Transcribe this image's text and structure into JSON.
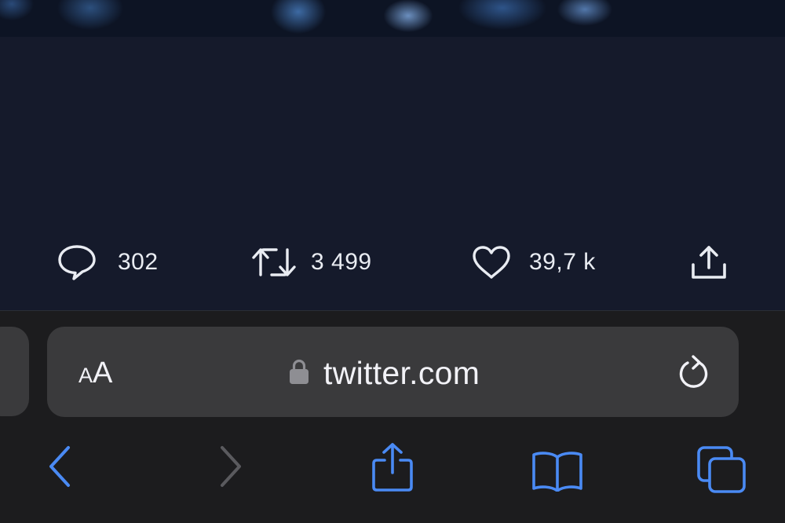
{
  "tweet": {
    "actions": {
      "reply_count": "302",
      "retweet_count": "3 499",
      "like_count": "39,7 k"
    }
  },
  "browser": {
    "address_bar": {
      "text_size_small": "A",
      "text_size_large": "A",
      "url": "twitter.com"
    },
    "toolbar": {
      "accent_color": "#4a8af4",
      "disabled_color": "#5a5a5e"
    }
  },
  "colors": {
    "tweet_background": "#151a2b",
    "browser_background": "#1c1c1e",
    "address_bar_background": "#3a3a3c"
  }
}
